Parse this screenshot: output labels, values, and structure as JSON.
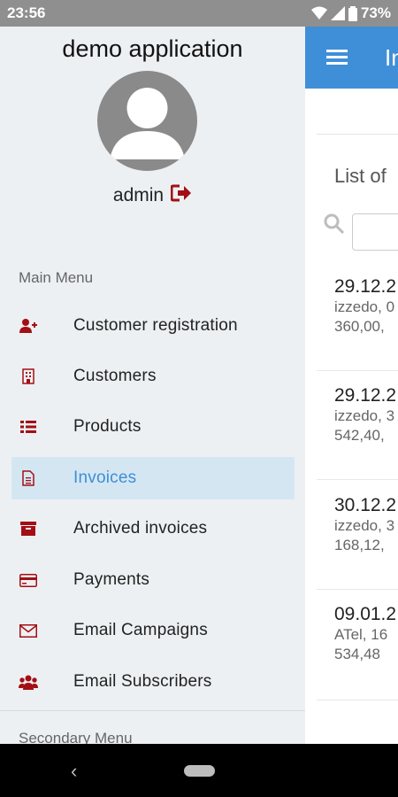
{
  "status": {
    "time": "23:56",
    "battery": "73%"
  },
  "background_app": {
    "title": "In",
    "list_title": "List of",
    "invoices": [
      {
        "date": "29.12.2",
        "line1": "izzedo, 0",
        "line2": "360,00,"
      },
      {
        "date": "29.12.2",
        "line1": "izzedo, 3",
        "line2": "542,40,"
      },
      {
        "date": "30.12.2",
        "line1": "izzedo, 3",
        "line2": "168,12,"
      },
      {
        "date": "09.01.2",
        "line1": "ATel, 16",
        "line2": "534,48"
      }
    ]
  },
  "drawer": {
    "app_name": "demo application",
    "user": "admin",
    "main_menu_label": "Main Menu",
    "items": [
      {
        "label": "Customer registration",
        "icon": "user-plus-icon"
      },
      {
        "label": "Customers",
        "icon": "building-icon"
      },
      {
        "label": "Products",
        "icon": "list-icon"
      },
      {
        "label": "Invoices",
        "icon": "file-text-icon"
      },
      {
        "label": "Archived invoices",
        "icon": "archive-icon"
      },
      {
        "label": "Payments",
        "icon": "credit-card-icon"
      },
      {
        "label": "Email Campaigns",
        "icon": "envelope-icon"
      },
      {
        "label": "Email Subscribers",
        "icon": "users-icon"
      }
    ],
    "secondary_menu_label": "Secondary Menu"
  },
  "colors": {
    "accent": "#3f8fd8",
    "icon": "#a30f14",
    "active_bg": "#d5e6f3"
  }
}
